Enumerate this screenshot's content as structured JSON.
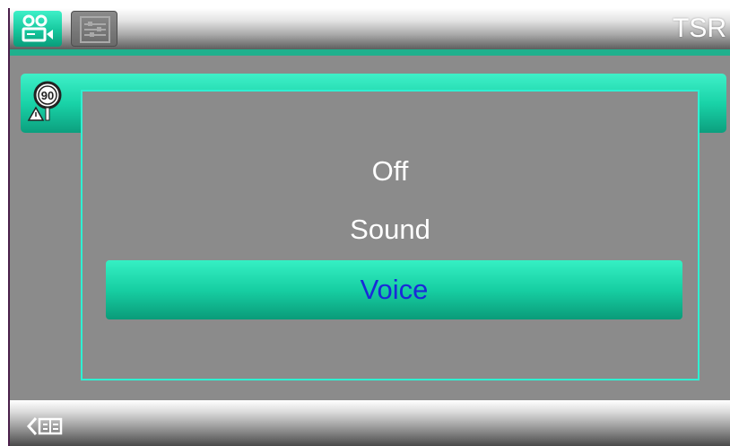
{
  "header": {
    "title": "TSR",
    "tabs": [
      {
        "icon": "camera-icon",
        "active": true
      },
      {
        "icon": "settings-menu-icon",
        "active": false
      }
    ]
  },
  "setting": {
    "icon": "speed-limit-sign-icon",
    "icon_text": "90"
  },
  "dialog": {
    "options": [
      "Off",
      "Sound",
      "Voice"
    ],
    "selected": "Voice"
  },
  "footer": {
    "back_icon": "back-icon"
  },
  "colors": {
    "accent": "#19d3a8",
    "dialog_border": "#2ef0d2",
    "selected_text": "#1a2ad8",
    "panel": "#8b8b8b"
  }
}
